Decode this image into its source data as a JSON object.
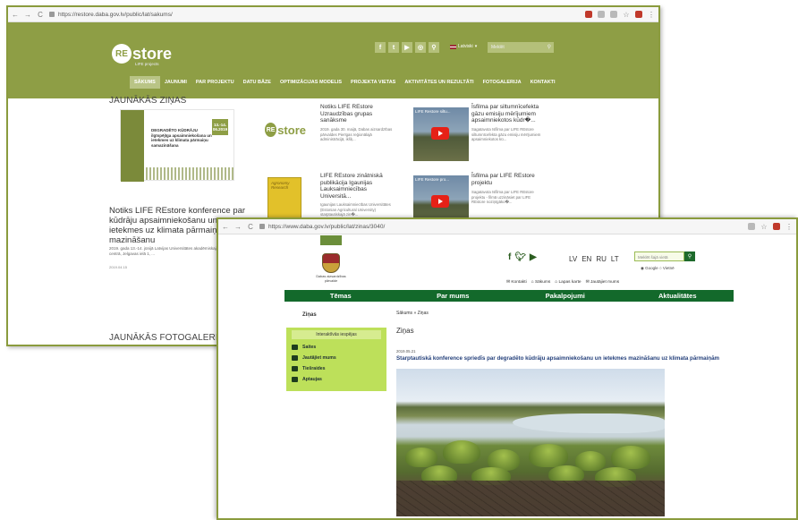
{
  "window1": {
    "url": "https://restore.daba.gov.lv/public/lat/sakums/",
    "logo": {
      "mark": "RE",
      "word": "store",
      "sub": "LIFE projects"
    },
    "social": [
      "f",
      "t",
      "▶",
      "◎",
      "⚲"
    ],
    "language": "Latviski",
    "search_placeholder": "Meklēt",
    "menu": [
      "SĀKUMS",
      "JAUNUMI",
      "PAR PROJEKTU",
      "DATU BĀZE",
      "OPTIMIZĀCIJAS MODELIS",
      "PROJEKTA VIETAS",
      "AKTIVITĀTES UN REZULTĀTI",
      "FOTOGALERIJA",
      "KONTAKTI"
    ],
    "section_title": "JAUNĀKĀS ZIŅAS",
    "feature": {
      "poster_text": "DEGRADĒTO KŪDRĀJU ilgtspējīga apsaimniekošana un ietekmes uz klimata pārmaiņu samazināšana",
      "poster_date": "13.-14. 06.2019",
      "title": "Notiks LIFE REstore konference par kūdrāju apsaimniekošanu un ietekmes uz klimata pārmaiņām mazināšanu",
      "meta": "2019. gada 13.-14. jūnijā Latvijas Universitātes akadēmiskajā centrā, Jelgavas ielā 1, ...",
      "date": "2019.04.15"
    },
    "news": [
      {
        "title": "Notiks LIFE REstore Uzraudzības grupas sanāksme",
        "text": "2019. gada 30. maijā, Dabas aizsardzības pārvaldes Pierīgas reģionālajā administrācijā, ikšķ..."
      },
      {
        "title": "Īsfilma par siltumnīcefekta gāzu emisiju mērījumiem apsaimniekotos kūdr�...",
        "text": "Sagatavota īsfilma par LIFE REstore siltumnīcefekta gāzu emisiju mērījumiem apsaimniekotos kū...",
        "video_label": "LIFE Restore siltu..."
      },
      {
        "title": "LIFE REstore zinātniskā publikācija Igaunijas Lauksaimniecības Universitā...",
        "text": "Igaunijas Lauksaimniecības Universitātes (Estonian Agricultural University) starptautiskajā zin�...",
        "book_label": "Agronomy Research"
      },
      {
        "title": "Īsfilma par LIFE REstore projektu",
        "text": "Sagatavota īsfilma par LIFE REstore projektu - filmā uzzināsiet par LIFE REstore noziņīgāko�...",
        "video_label": "LIFE Restore pro..."
      }
    ],
    "gallery_title": "JAUNĀKĀS FOTOGALERIJA"
  },
  "window2": {
    "url": "https://www.daba.gov.lv/public/lat/zinas/3040/",
    "logo_text": "Dabas aizsardzības pārvalde",
    "languages": [
      "LV",
      "EN",
      "RU",
      "LT"
    ],
    "search_placeholder": "Meklēt šajā vietā",
    "search_options": "◉ Google ○ Vietnē",
    "utility_links": [
      "Kontakti",
      "Sākums",
      "Lapas karte",
      "Jautājiet mums"
    ],
    "menu": [
      "Tēmas",
      "Par mums",
      "Pakalpojumi",
      "Aktualitātes"
    ],
    "sidebar_title": "Ziņas",
    "panel_title": "Interaktīvās iespējas",
    "panel_items": [
      "Saites",
      "Jautājiet mums",
      "Tiešraides",
      "Aptaujas"
    ],
    "breadcrumb": "Sākums » Ziņas",
    "page_title": "Ziņas",
    "article_date": "2019.05.21",
    "article_title": "Starptautiskā konference spriedīs par degradēto kūdrāju apsaimniekošanu un ietekmes mazināšanu uz klimata pārmaiņām"
  }
}
